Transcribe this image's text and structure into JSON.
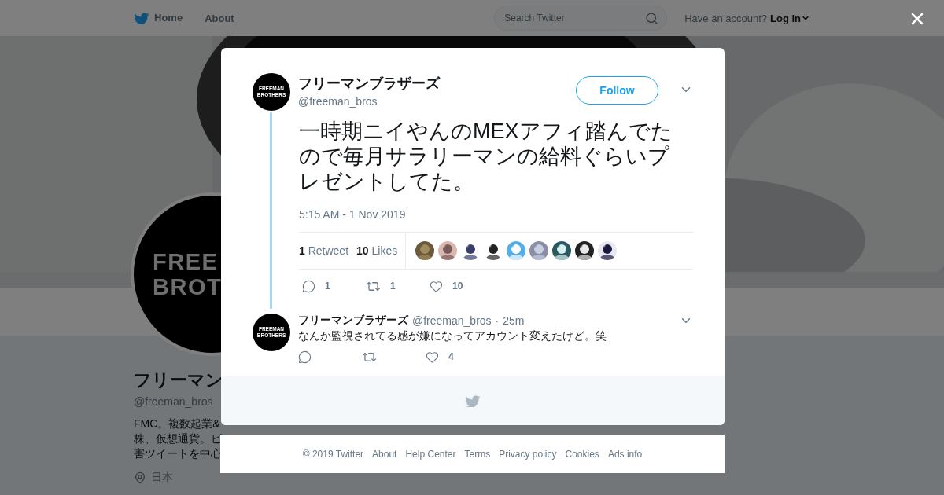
{
  "nav": {
    "items": [
      {
        "label": "Home",
        "kind": "home"
      },
      {
        "label": "About",
        "kind": "plain"
      }
    ],
    "search": {
      "placeholder": "Search Twitter"
    },
    "account_prompt": "Have an account?",
    "login": "Log in"
  },
  "profile": {
    "avatar_lines": [
      "FREE",
      "BROT"
    ],
    "name": "フリーマン",
    "handle": "@freeman_bros",
    "bio_lines": [
      "FMC。複数起業&",
      "株、仮想通貨。ビ",
      "害ツイートを中心"
    ],
    "location": "日本"
  },
  "dialog": {
    "tweet": {
      "avatar_lines": [
        "FREEMAN",
        "BROTHERS"
      ],
      "name": "フリーマンブラザーズ",
      "handle": "@freeman_bros",
      "follow": "Follow",
      "text": "一時期ニイやんのMEXアフィ踏んでたので毎月サラリーマンの給料ぐらいプレゼントしてた。",
      "timestamp": "5:15 AM - 1 Nov 2019",
      "stats": [
        {
          "count": "1",
          "label": "Retweet"
        },
        {
          "count": "10",
          "label": "Likes"
        }
      ],
      "likers": [
        {
          "kind": "picture"
        },
        {
          "kind": "picture"
        },
        {
          "kind": "picture"
        },
        {
          "kind": "picture"
        },
        {
          "kind": "picture"
        },
        {
          "kind": "picture"
        },
        {
          "kind": "picture"
        },
        {
          "kind": "picture"
        },
        {
          "kind": "picture"
        }
      ],
      "actions": [
        {
          "kind": "reply",
          "count": "1"
        },
        {
          "kind": "retweet",
          "count": "1"
        },
        {
          "kind": "like",
          "count": "10"
        }
      ]
    },
    "reply": {
      "avatar_lines": [
        "FREEMAN",
        "BROTHERS"
      ],
      "name": "フリーマンブラザーズ",
      "handle": "@freeman_bros",
      "dot": "·",
      "time": "25m",
      "text": "なんか監視されてる感が嫌になってアカウント変えたけど。笑",
      "actions": [
        {
          "kind": "reply"
        },
        {
          "kind": "retweet"
        },
        {
          "kind": "like",
          "count": "4"
        }
      ]
    }
  },
  "footer": {
    "links": [
      "© 2019 Twitter",
      "About",
      "Help Center",
      "Terms",
      "Privacy policy",
      "Cookies",
      "Ads info"
    ]
  }
}
